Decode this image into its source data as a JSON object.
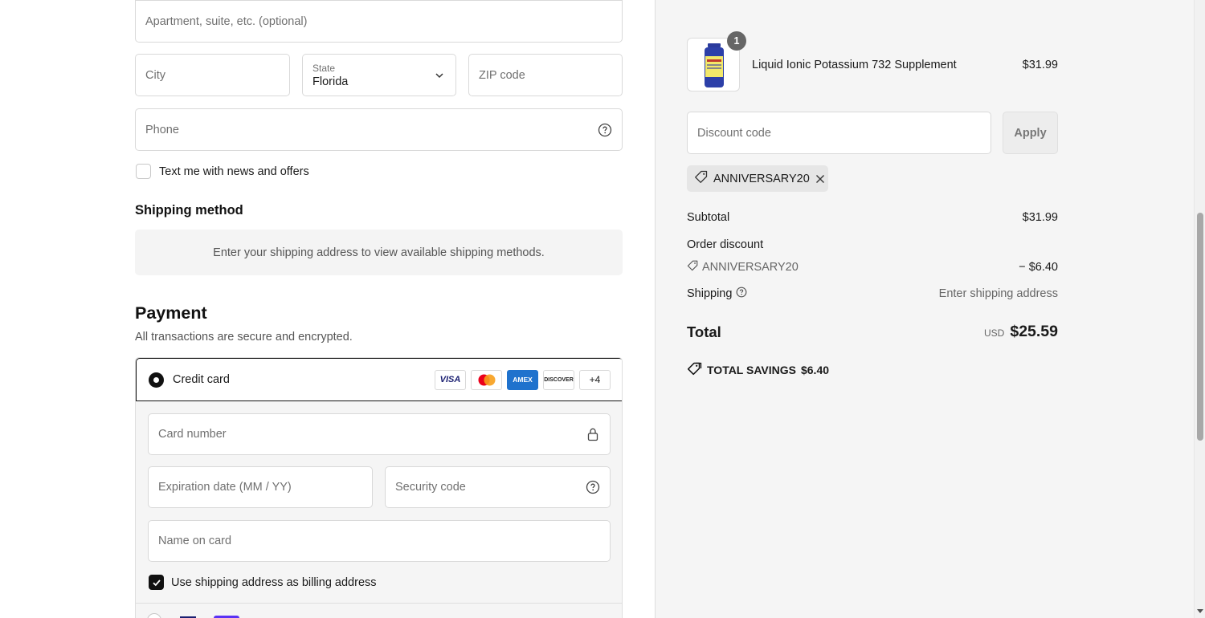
{
  "address": {
    "apartment_placeholder": "Apartment, suite, etc. (optional)",
    "city_placeholder": "City",
    "state_label": "State",
    "state_value": "Florida",
    "zip_placeholder": "ZIP code",
    "phone_placeholder": "Phone",
    "text_offers_label": "Text me with news and offers"
  },
  "shipping_method": {
    "heading": "Shipping method",
    "notice": "Enter your shipping address to view available shipping methods."
  },
  "payment": {
    "heading": "Payment",
    "subtitle": "All transactions are secure and encrypted.",
    "method_label": "Credit card",
    "card_brands": [
      "VISA",
      "MC",
      "AMEX",
      "DISCOVER",
      "+4"
    ],
    "card_number_placeholder": "Card number",
    "expiration_placeholder": "Expiration date (MM / YY)",
    "security_placeholder": "Security code",
    "name_placeholder": "Name on card",
    "billing_same_label": "Use shipping address as billing address"
  },
  "summary": {
    "item": {
      "quantity": "1",
      "name": "Liquid Ionic Potassium 732 Supplement",
      "price": "$31.99"
    },
    "discount_placeholder": "Discount code",
    "apply_label": "Apply",
    "applied_code": "ANNIVERSARY20",
    "subtotal_label": "Subtotal",
    "subtotal_value": "$31.99",
    "order_discount_label": "Order discount",
    "discount_code": "ANNIVERSARY20",
    "discount_value": "− $6.40",
    "shipping_label": "Shipping",
    "shipping_value": "Enter shipping address",
    "total_label": "Total",
    "currency": "USD",
    "total_value": "$25.59",
    "savings_label": "TOTAL SAVINGS",
    "savings_value": "$6.40"
  },
  "colors": {
    "accent": "#111111",
    "panel_bg": "#f5f5f5",
    "amex_blue": "#1f72cd",
    "visa_blue": "#1a1f71",
    "mc_red": "#eb001b",
    "mc_orange": "#f79e1b"
  }
}
